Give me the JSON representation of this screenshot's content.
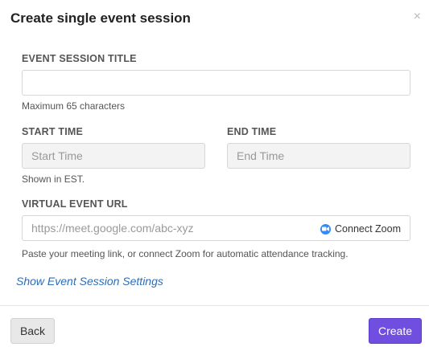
{
  "dialog": {
    "title": "Create single event session",
    "close_symbol": "×"
  },
  "form": {
    "session_title": {
      "label": "EVENT SESSION TITLE",
      "value": "",
      "hint": "Maximum 65 characters"
    },
    "start_time": {
      "label": "START TIME",
      "placeholder": "Start Time"
    },
    "end_time": {
      "label": "END TIME",
      "placeholder": "End Time"
    },
    "time_hint": "Shown in EST.",
    "virtual_url": {
      "label": "VIRTUAL EVENT URL",
      "placeholder": "https://meet.google.com/abc-xyz",
      "zoom_button_label": "Connect Zoom",
      "zoom_icon": "zoom-camera-icon",
      "hint": "Paste your meeting link, or connect Zoom for automatic attendance tracking."
    },
    "settings_link": "Show Event Session Settings"
  },
  "footer": {
    "back_label": "Back",
    "create_label": "Create"
  },
  "colors": {
    "primary": "#6f4ee0",
    "link": "#2a6db8",
    "zoom": "#2d8cff"
  }
}
